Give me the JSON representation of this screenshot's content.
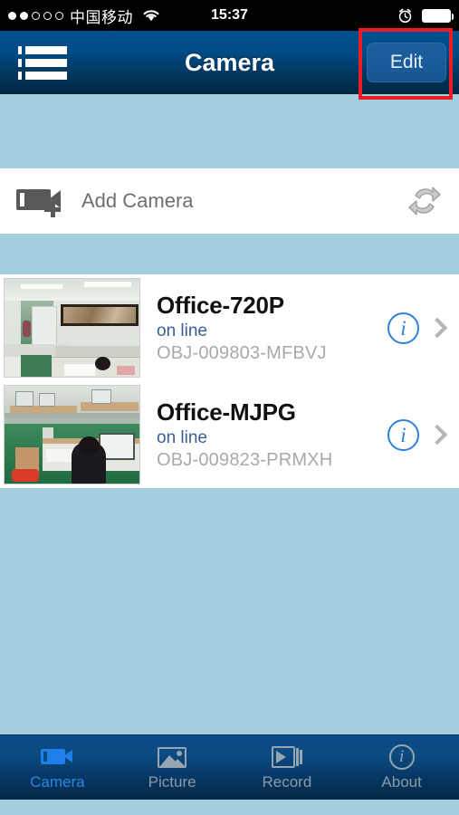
{
  "status_bar": {
    "signal_dots_total": 5,
    "signal_dots_filled": 2,
    "carrier": "中国移动",
    "wifi_icon": "wifi-icon",
    "time": "15:37",
    "alarm_icon": "alarm-clock-icon",
    "battery_icon": "battery-full-icon"
  },
  "nav_bar": {
    "menu_icon": "list-menu-icon",
    "title": "Camera",
    "edit_label": "Edit",
    "highlight_color": "#ed1c24"
  },
  "add_camera": {
    "icon": "camera-add-icon",
    "label": "Add Camera",
    "refresh_icon": "refresh-sync-icon"
  },
  "cameras": [
    {
      "name": "Office-720P",
      "status": "on line",
      "uid": "OBJ-009803-MFBVJ",
      "thumbnail": "office-room-thumbnail",
      "info_icon": "info-circle-icon",
      "chevron_icon": "chevron-right-icon"
    },
    {
      "name": "Office-MJPG",
      "status": "on line",
      "uid": "OBJ-009823-PRMXH",
      "thumbnail": "office-desks-thumbnail",
      "info_icon": "info-circle-icon",
      "chevron_icon": "chevron-right-icon"
    }
  ],
  "tab_bar": {
    "active_index": 0,
    "active_color": "#2d86e8",
    "inactive_color": "#8a9aa8",
    "tabs": [
      {
        "label": "Camera",
        "icon": "video-camera-icon"
      },
      {
        "label": "Picture",
        "icon": "photo-icon"
      },
      {
        "label": "Record",
        "icon": "play-stack-icon"
      },
      {
        "label": "About",
        "icon": "info-circle-icon"
      }
    ]
  },
  "theme": {
    "background": "#a4cedd",
    "nav_top": "#00528f",
    "nav_bottom": "#01253f",
    "status_link": "#3c5e95",
    "uid_gray": "#a9a9a9"
  }
}
